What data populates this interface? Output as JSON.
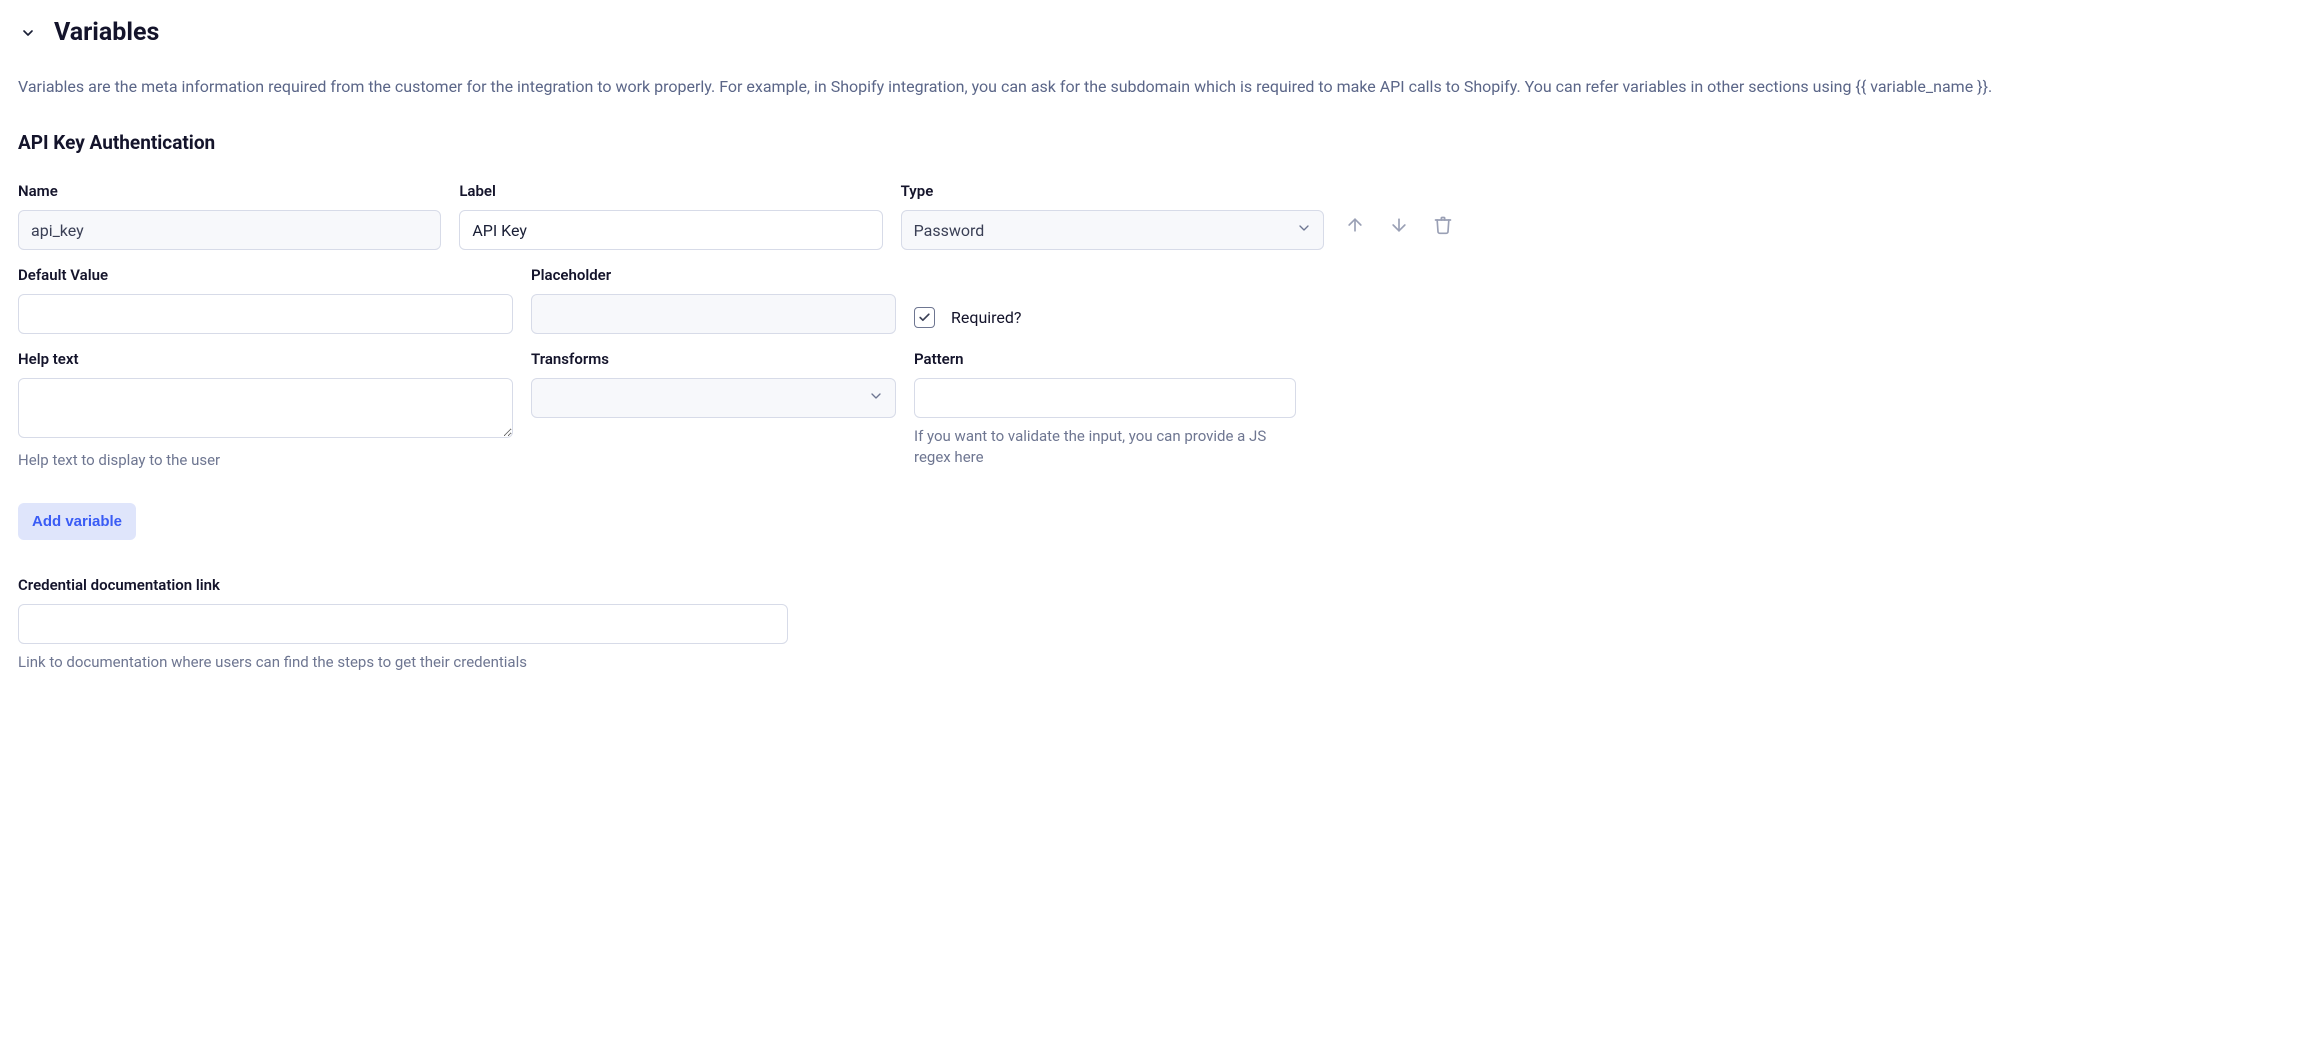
{
  "section": {
    "title": "Variables",
    "description": "Variables are the meta information required from the customer for the integration to work properly. For example, in Shopify integration, you can ask for the subdomain which is required to make API calls to Shopify. You can refer variables in other sections using {{ variable_name }}."
  },
  "subsection": {
    "title": "API Key Authentication"
  },
  "labels": {
    "name": "Name",
    "label": "Label",
    "type": "Type",
    "default_value": "Default Value",
    "placeholder": "Placeholder",
    "required": "Required?",
    "help_text": "Help text",
    "transforms": "Transforms",
    "pattern": "Pattern",
    "credential_doc": "Credential documentation link"
  },
  "variable": {
    "name_value": "api_key",
    "label_value": "API Key",
    "type_value": "Password",
    "default_value": "",
    "placeholder_value": "",
    "required_checked": true,
    "help_text_value": "",
    "transforms_value": "",
    "pattern_value": ""
  },
  "hints": {
    "help_text_hint": "Help text to display to the user",
    "pattern_hint": "If you want to validate the input, you can provide a JS regex here",
    "credential_hint": "Link to documentation where users can find the steps to get their credentials"
  },
  "buttons": {
    "add_variable": "Add variable"
  },
  "credential_doc_value": ""
}
